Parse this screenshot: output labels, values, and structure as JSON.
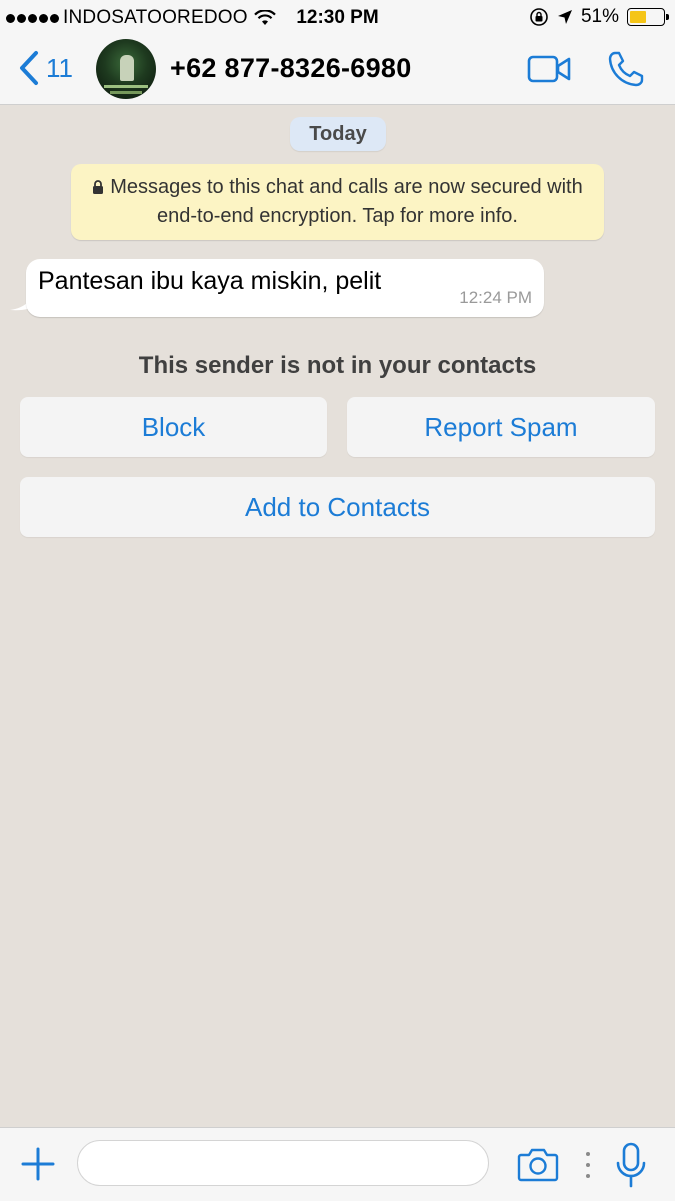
{
  "status_bar": {
    "carrier": "INDOSATOOREDOO",
    "time": "12:30 PM",
    "battery": "51%",
    "battery_level": 0.51,
    "icons": [
      "signal-dots-icon",
      "wifi-icon",
      "orientation-lock-icon",
      "location-arrow-icon",
      "battery-icon"
    ]
  },
  "header": {
    "back_count": "11",
    "contact_name": "+62 877-8326-6980",
    "icons": [
      "chevron-left-icon",
      "avatar",
      "video-call-icon",
      "phone-call-icon"
    ]
  },
  "chat": {
    "date_label": "Today",
    "encryption_notice": "Messages to this chat and calls are now secured with end-to-end encryption. Tap for more info.",
    "messages": [
      {
        "text": "Pantesan ibu kaya miskin, pelit",
        "time": "12:24 PM",
        "direction": "incoming"
      }
    ],
    "sender_notice": "This sender is not in your contacts",
    "actions": {
      "block": "Block",
      "report_spam": "Report Spam",
      "add_to_contacts": "Add to Contacts"
    }
  },
  "input_bar": {
    "placeholder": "",
    "icons": [
      "plus-icon",
      "camera-icon",
      "more-dots-icon",
      "microphone-icon"
    ]
  },
  "colors": {
    "accent": "#1c7cd6",
    "chat_background": "#e5e0da",
    "encryption_background": "#fcf4c4",
    "date_pill": "#dde8f6",
    "battery_fill": "#f5c518"
  }
}
